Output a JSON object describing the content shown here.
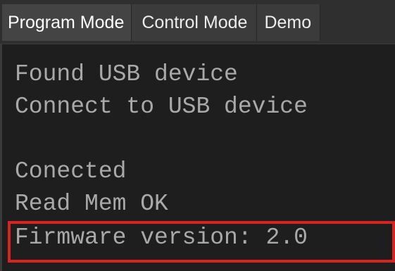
{
  "tabs": [
    {
      "label": "Program Mode",
      "active": true
    },
    {
      "label": "Control Mode",
      "active": false
    },
    {
      "label": "Demo",
      "active": false
    }
  ],
  "console": {
    "lines": [
      "Found USB device",
      "Connect to USB device",
      "",
      "Conected",
      "Read Mem OK",
      "Firmware version: 2.0"
    ]
  },
  "colors": {
    "console_background": "#1e1e1e",
    "console_text": "#a9a9a9",
    "highlight_border": "#d92323",
    "tab_background": "#3b3b3b"
  }
}
